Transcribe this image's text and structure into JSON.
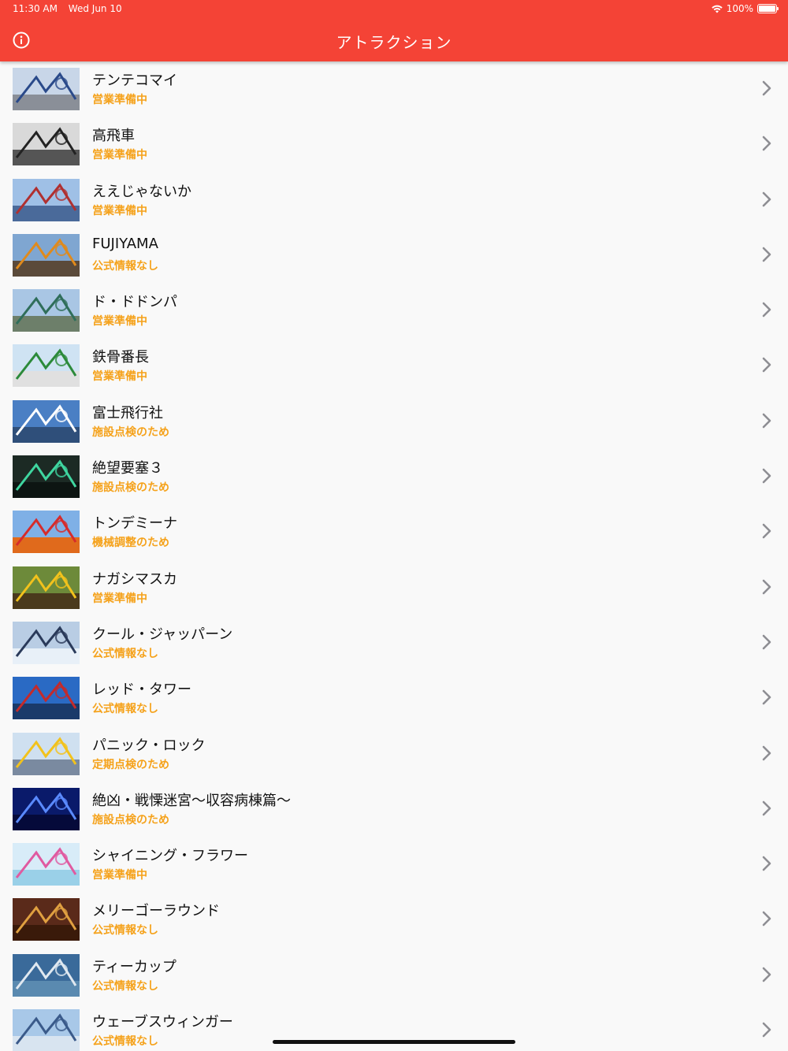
{
  "status_bar": {
    "time": "11:30 AM",
    "date": "Wed Jun 10",
    "battery": "100%"
  },
  "header": {
    "title": "アトラクション",
    "info_icon": "info-circle-icon",
    "background_color": "#f44336"
  },
  "colors": {
    "status_text": "#f5a21b",
    "name_text": "#111111",
    "chevron": "#8e8e93"
  },
  "attractions": [
    {
      "name": "テンテコマイ",
      "status": "営業準備中",
      "thumb": {
        "sky": "#c8d6e8",
        "accent": "#2a4a8a",
        "ground": "#8a8f98"
      }
    },
    {
      "name": "高飛車",
      "status": "営業準備中",
      "thumb": {
        "sky": "#d9d9d9",
        "accent": "#222222",
        "ground": "#555555"
      }
    },
    {
      "name": "ええじゃないか",
      "status": "営業準備中",
      "thumb": {
        "sky": "#9fc0e6",
        "accent": "#b03030",
        "ground": "#4a6a9a"
      }
    },
    {
      "name": "FUJIYAMA",
      "status": "公式情報なし",
      "thumb": {
        "sky": "#7fa6d1",
        "accent": "#e08a1c",
        "ground": "#5b4a3a"
      }
    },
    {
      "name": "ド・ドドンパ",
      "status": "営業準備中",
      "thumb": {
        "sky": "#a9c6e4",
        "accent": "#2f6e5a",
        "ground": "#6d7f6a"
      }
    },
    {
      "name": "鉄骨番長",
      "status": "営業準備中",
      "thumb": {
        "sky": "#cfe3f3",
        "accent": "#2c8a3a",
        "ground": "#e0e0e0"
      }
    },
    {
      "name": "富士飛行社",
      "status": "施設点検のため",
      "thumb": {
        "sky": "#4a7fc4",
        "accent": "#ffffff",
        "ground": "#2f4f7a"
      }
    },
    {
      "name": "絶望要塞３",
      "status": "施設点検のため",
      "thumb": {
        "sky": "#1c2a24",
        "accent": "#3fd6a0",
        "ground": "#0d1512"
      }
    },
    {
      "name": "トンデミーナ",
      "status": "機械調整のため",
      "thumb": {
        "sky": "#7fb0e6",
        "accent": "#d62b2b",
        "ground": "#e06a1c"
      }
    },
    {
      "name": "ナガシマスカ",
      "status": "営業準備中",
      "thumb": {
        "sky": "#6d8a3a",
        "accent": "#f2c21c",
        "ground": "#4a3a1c"
      }
    },
    {
      "name": "クール・ジャッパーン",
      "status": "公式情報なし",
      "thumb": {
        "sky": "#b9cde4",
        "accent": "#2a3a5a",
        "ground": "#e8f0f8"
      }
    },
    {
      "name": "レッド・タワー",
      "status": "公式情報なし",
      "thumb": {
        "sky": "#2a6ac4",
        "accent": "#c42a2a",
        "ground": "#1a3a6a"
      }
    },
    {
      "name": "パニック・ロック",
      "status": "定期点検のため",
      "thumb": {
        "sky": "#cfe0f0",
        "accent": "#f2c21c",
        "ground": "#7a8aa0"
      }
    },
    {
      "name": "絶凶・戦慄迷宮〜収容病棟篇〜",
      "status": "施設点検のため",
      "thumb": {
        "sky": "#0a1a6a",
        "accent": "#5a8aff",
        "ground": "#050a3a"
      }
    },
    {
      "name": "シャイニング・フラワー",
      "status": "営業準備中",
      "thumb": {
        "sky": "#d8ecf8",
        "accent": "#e05aa0",
        "ground": "#9ad0e8"
      }
    },
    {
      "name": "メリーゴーラウンド",
      "status": "公式情報なし",
      "thumb": {
        "sky": "#5a2a1a",
        "accent": "#e0a040",
        "ground": "#3a1a0a"
      }
    },
    {
      "name": "ティーカップ",
      "status": "公式情報なし",
      "thumb": {
        "sky": "#3a6a9a",
        "accent": "#e0e8f0",
        "ground": "#5a8ab0"
      }
    },
    {
      "name": "ウェーブスウィンガー",
      "status": "公式情報なし",
      "thumb": {
        "sky": "#a8c8e8",
        "accent": "#3a5a8a",
        "ground": "#d8e4f0"
      }
    }
  ]
}
